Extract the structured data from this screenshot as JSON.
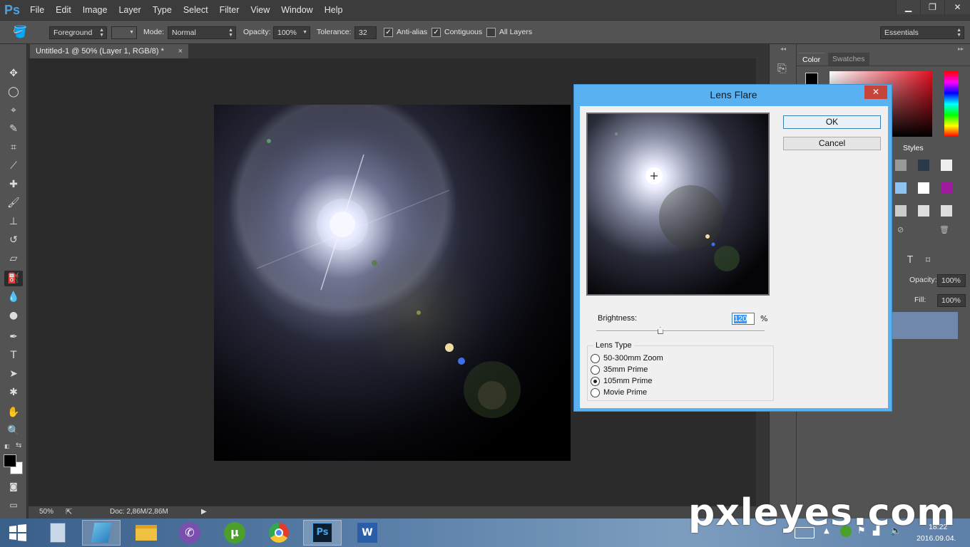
{
  "app": {
    "logo": "Ps"
  },
  "menu": [
    "File",
    "Edit",
    "Image",
    "Layer",
    "Type",
    "Select",
    "Filter",
    "View",
    "Window",
    "Help"
  ],
  "options": {
    "fill_source": "Foreground",
    "mode_label": "Mode:",
    "mode_value": "Normal",
    "opacity_label": "Opacity:",
    "opacity_value": "100%",
    "tolerance_label": "Tolerance:",
    "tolerance_value": "32",
    "anti_alias": "Anti-alias",
    "contiguous": "Contiguous",
    "all_layers": "All Layers",
    "workspace": "Essentials"
  },
  "document": {
    "tab_title": "Untitled-1 @ 50% (Layer 1, RGB/8) *",
    "close": "×"
  },
  "status": {
    "zoom": "50%",
    "doc_size": "Doc: 2,86M/2,86M"
  },
  "panels": {
    "color_tab": "Color",
    "swatches_tab": "Swatches",
    "styles_tab": "Styles",
    "opacity_label": "Opacity:",
    "opacity_value": "100%",
    "fill_label": "Fill:",
    "fill_value": "100%",
    "type_glyph": "T"
  },
  "dialog": {
    "title": "Lens Flare",
    "close": "✕",
    "ok": "OK",
    "cancel": "Cancel",
    "brightness_label": "Brightness:",
    "brightness_value": "120",
    "brightness_unit": "%",
    "brightness_slider_fraction": 0.38,
    "lens_type_label": "Lens Type",
    "lens_types": [
      "50-300mm Zoom",
      "35mm Prime",
      "105mm Prime",
      "Movie Prime"
    ],
    "selected_lens": "105mm Prime"
  },
  "taskbar": {
    "apps": [
      "windows-start",
      "calculator",
      "notes",
      "file-explorer",
      "viber",
      "utorrent",
      "chrome",
      "photoshop",
      "word"
    ],
    "clock_time": "18:22",
    "clock_date": "2016.09.04."
  },
  "watermark": "pxleyes.com"
}
